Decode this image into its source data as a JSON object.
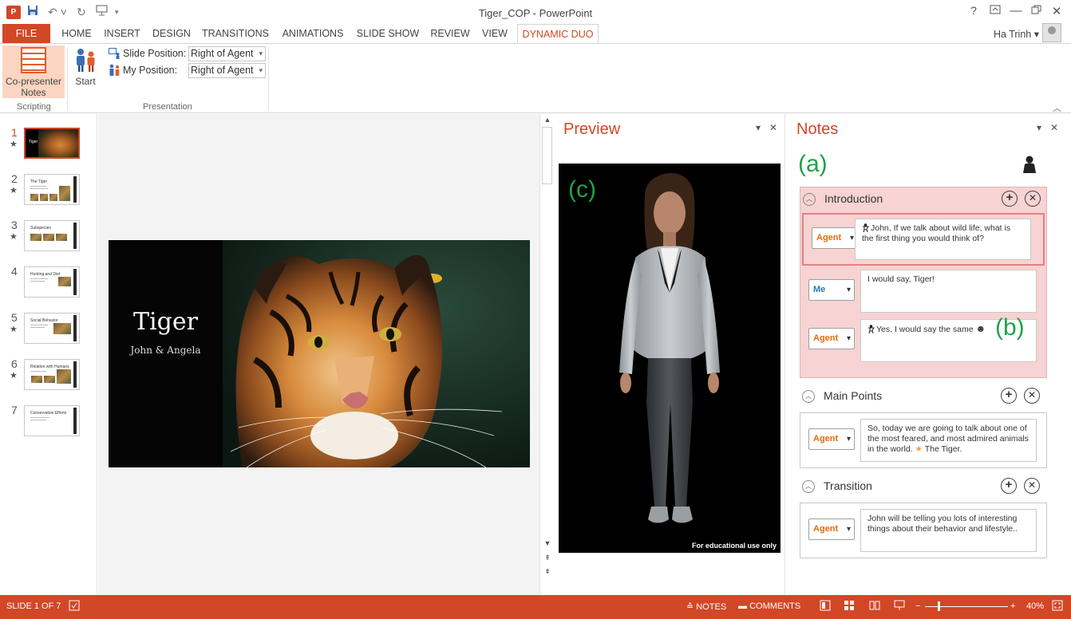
{
  "window": {
    "title": "Tiger_COP - PowerPoint",
    "help_label": "?",
    "user_name": "Ha Trinh"
  },
  "tabs": [
    "FILE",
    "HOME",
    "INSERT",
    "DESIGN",
    "TRANSITIONS",
    "ANIMATIONS",
    "SLIDE SHOW",
    "REVIEW",
    "VIEW",
    "DYNAMIC DUO"
  ],
  "ribbon": {
    "copresenter_label_1": "Co-presenter",
    "copresenter_label_2": "Notes",
    "start_label": "Start",
    "slide_position_label": "Slide Position:",
    "slide_position_value": "Right of Agent",
    "my_position_label": "My Position:",
    "my_position_value": "Right of Agent",
    "group_scripting": "Scripting",
    "group_presentation": "Presentation"
  },
  "thumbnails": [
    {
      "num": "1",
      "star": true,
      "title": "Tiger"
    },
    {
      "num": "2",
      "star": true,
      "title": "The Tiger"
    },
    {
      "num": "3",
      "star": true,
      "title": "Subspecies"
    },
    {
      "num": "4",
      "star": false,
      "title": "Hunting and Diet"
    },
    {
      "num": "5",
      "star": true,
      "title": "Social Behavior"
    },
    {
      "num": "6",
      "star": true,
      "title": "Relation with Humans"
    },
    {
      "num": "7",
      "star": false,
      "title": "Conservation Efforts"
    }
  ],
  "slide": {
    "title": "Tiger",
    "subtitle": "John & Angela"
  },
  "preview": {
    "title": "Preview",
    "label_c": "(c)",
    "watermark": "For educational use only"
  },
  "notes": {
    "title": "Notes",
    "label_a": "(a)",
    "label_b": "(b)",
    "sections": [
      {
        "title": "Introduction",
        "rows": [
          {
            "role": "Agent",
            "text": "John, If we talk about wild life, what is the first thing you would think of?"
          },
          {
            "role": "Me",
            "text": "I would say, Tiger!"
          },
          {
            "role": "Agent",
            "text": "Yes, I would say the same"
          }
        ]
      },
      {
        "title": "Main Points",
        "rows": [
          {
            "role": "Agent",
            "text": "So, today we are going to talk about one of the most feared, and most admired animals in the world.",
            "tail": "The Tiger."
          }
        ]
      },
      {
        "title": "Transition",
        "rows": [
          {
            "role": "Agent",
            "text": "John will be telling you lots of interesting things about their behavior and lifestyle.."
          }
        ]
      }
    ]
  },
  "statusbar": {
    "slide_info": "SLIDE 1 OF 7",
    "notes_label": "NOTES",
    "comments_label": "COMMENTS",
    "zoom": "40%"
  },
  "colors": {
    "accent": "#d24726",
    "agent_role": "#e46c0a",
    "me_role": "#2e75b6",
    "annotation_green": "#1fa34a",
    "intro_bg": "#f7d3d3"
  }
}
